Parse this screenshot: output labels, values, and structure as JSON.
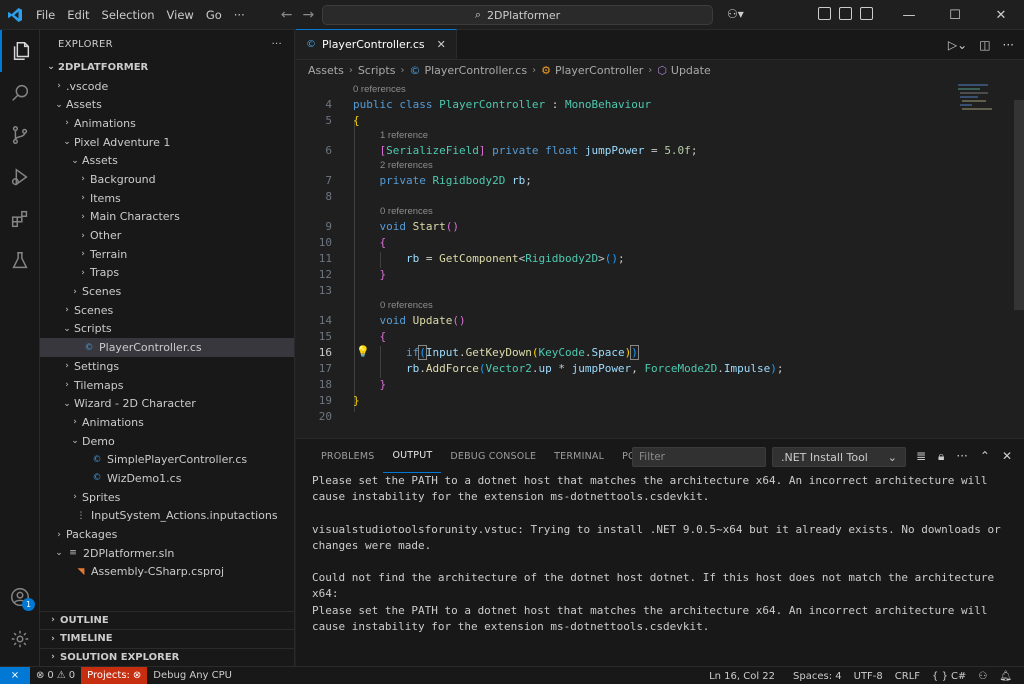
{
  "titlebar": {
    "menu": [
      "File",
      "Edit",
      "Selection",
      "View",
      "Go",
      "···"
    ],
    "search_text": "2DPlatformer"
  },
  "sidebar": {
    "title": "EXPLORER",
    "root": "2DPLATFORMER",
    "tree": [
      {
        "label": ".vscode",
        "depth": 1,
        "kind": "folder",
        "open": false
      },
      {
        "label": "Assets",
        "depth": 1,
        "kind": "folder",
        "open": true
      },
      {
        "label": "Animations",
        "depth": 2,
        "kind": "folder",
        "open": false
      },
      {
        "label": "Pixel Adventure 1",
        "depth": 2,
        "kind": "folder",
        "open": true
      },
      {
        "label": "Assets",
        "depth": 3,
        "kind": "folder",
        "open": true
      },
      {
        "label": "Background",
        "depth": 4,
        "kind": "folder",
        "open": false
      },
      {
        "label": "Items",
        "depth": 4,
        "kind": "folder",
        "open": false
      },
      {
        "label": "Main Characters",
        "depth": 4,
        "kind": "folder",
        "open": false
      },
      {
        "label": "Other",
        "depth": 4,
        "kind": "folder",
        "open": false
      },
      {
        "label": "Terrain",
        "depth": 4,
        "kind": "folder",
        "open": false
      },
      {
        "label": "Traps",
        "depth": 4,
        "kind": "folder",
        "open": false
      },
      {
        "label": "Scenes",
        "depth": 3,
        "kind": "folder",
        "open": false
      },
      {
        "label": "Scenes",
        "depth": 2,
        "kind": "folder",
        "open": false
      },
      {
        "label": "Scripts",
        "depth": 2,
        "kind": "folder",
        "open": true
      },
      {
        "label": "PlayerController.cs",
        "depth": 3,
        "kind": "cs",
        "selected": true
      },
      {
        "label": "Settings",
        "depth": 2,
        "kind": "folder",
        "open": false
      },
      {
        "label": "Tilemaps",
        "depth": 2,
        "kind": "folder",
        "open": false
      },
      {
        "label": "Wizard - 2D Character",
        "depth": 2,
        "kind": "folder",
        "open": true
      },
      {
        "label": "Animations",
        "depth": 3,
        "kind": "folder",
        "open": false
      },
      {
        "label": "Demo",
        "depth": 3,
        "kind": "folder",
        "open": true
      },
      {
        "label": "SimplePlayerController.cs",
        "depth": 4,
        "kind": "cs"
      },
      {
        "label": "WizDemo1.cs",
        "depth": 4,
        "kind": "cs"
      },
      {
        "label": "Sprites",
        "depth": 3,
        "kind": "folder",
        "open": false
      },
      {
        "label": "InputSystem_Actions.inputactions",
        "depth": 2,
        "kind": "json"
      },
      {
        "label": "Packages",
        "depth": 1,
        "kind": "folder",
        "open": false
      },
      {
        "label": "2DPlatformer.sln",
        "depth": 1,
        "kind": "sln",
        "open": true
      },
      {
        "label": "Assembly-CSharp.csproj",
        "depth": 2,
        "kind": "proj"
      }
    ],
    "sections": [
      "OUTLINE",
      "TIMELINE",
      "SOLUTION EXPLORER"
    ]
  },
  "activity": {
    "accounts_badge": "1"
  },
  "editor": {
    "tab_label": "PlayerController.cs",
    "breadcrumb": [
      "Assets",
      "Scripts",
      "PlayerController.cs",
      "PlayerController",
      "Update"
    ],
    "lens": {
      "l4": "0 references",
      "l6": "1 reference",
      "l7": "2 references",
      "l9": "0 references",
      "l14": "0 references"
    },
    "line_numbers": [
      "4",
      "5",
      "6",
      "7",
      "8",
      "9",
      "10",
      "11",
      "12",
      "13",
      "14",
      "15",
      "16",
      "17",
      "18",
      "19",
      "20"
    ]
  },
  "panel": {
    "tabs": [
      "PROBLEMS",
      "OUTPUT",
      "DEBUG CONSOLE",
      "TERMINAL",
      "PORTS"
    ],
    "active_tab": "OUTPUT",
    "filter_placeholder": "Filter",
    "channel": ".NET Install Tool",
    "output_lines": [
      "Please set the PATH to a dotnet host that matches the architecture x64. An incorrect architecture will",
      "cause instability for the extension ms-dotnettools.csdevkit.",
      "",
      "visualstudiotoolsforunity.vstuc: Trying to install .NET 9.0.5~x64 but it already exists. No downloads or",
      "changes were made.",
      "",
      "Could not find the architecture of the dotnet host dotnet. If this host does not match the architecture",
      "x64:",
      "Please set the PATH to a dotnet host that matches the architecture x64. An incorrect architecture will",
      "cause instability for the extension ms-dotnettools.csdevkit."
    ]
  },
  "statusbar": {
    "errors": "0",
    "warnings": "0",
    "projects": "Projects:",
    "debug": "Debug Any CPU",
    "position": "Ln 16, Col 22",
    "spaces": "Spaces: 4",
    "encoding": "UTF-8",
    "eol": "CRLF",
    "language": "C#"
  },
  "colors": {
    "accent": "#0078d4",
    "projects_error": "#c72e0f"
  }
}
